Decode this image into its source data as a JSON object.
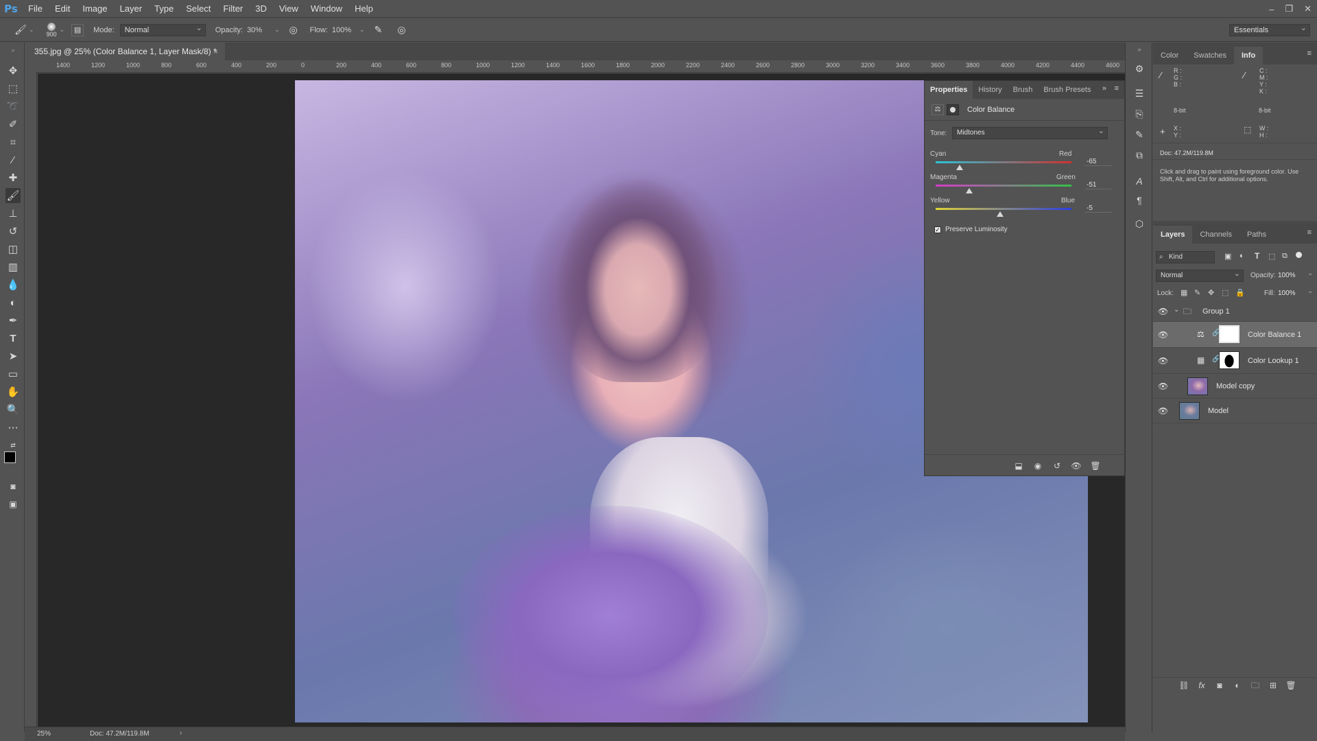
{
  "app": {
    "logo": "Ps"
  },
  "menu": [
    "File",
    "Edit",
    "Image",
    "Layer",
    "Type",
    "Select",
    "Filter",
    "3D",
    "View",
    "Window",
    "Help"
  ],
  "window_controls": {
    "minimize": "–",
    "restore": "❐",
    "close": "✕"
  },
  "options": {
    "brush_size": "900",
    "mode_label": "Mode:",
    "mode_value": "Normal",
    "opacity_label": "Opacity:",
    "opacity_value": "30%",
    "flow_label": "Flow:",
    "flow_value": "100%",
    "workspace": "Essentials"
  },
  "document": {
    "tab_title": "355.jpg @ 25% (Color Balance 1, Layer Mask/8) *",
    "close": "×",
    "ruler_h": [
      "1400",
      "1200",
      "1000",
      "800",
      "600",
      "400",
      "200",
      "0",
      "200",
      "400",
      "600",
      "800",
      "1000",
      "1200",
      "1400",
      "1600",
      "1800",
      "2000",
      "2200",
      "2400",
      "2600",
      "2800",
      "3000",
      "3200",
      "3400",
      "3600",
      "3800",
      "4000",
      "4200",
      "4400",
      "4600"
    ]
  },
  "status": {
    "zoom": "25%",
    "doc": "Doc: 47.2M/119.8M",
    "arrow": "›"
  },
  "properties": {
    "tabs": [
      "Properties",
      "History",
      "Brush",
      "Brush Presets"
    ],
    "title": "Color Balance",
    "tone_label": "Tone:",
    "tone_value": "Midtones",
    "sliders": [
      {
        "left": "Cyan",
        "right": "Red",
        "value": "-65",
        "amount": -65
      },
      {
        "left": "Magenta",
        "right": "Green",
        "value": "-51",
        "amount": -51
      },
      {
        "left": "Yellow",
        "right": "Blue",
        "value": "-5",
        "amount": -5
      }
    ],
    "preserve_label": "Preserve Luminosity",
    "preserve_checked": true
  },
  "info": {
    "tabs": [
      "Color",
      "Swatches",
      "Info"
    ],
    "rgb_labels": "R :\nG :\nB :",
    "cmyk_labels": "C :\nM :\nY :\nK :",
    "bit_left": "8-bit",
    "bit_right": "8-bit",
    "xy_labels": "X :\nY :",
    "wh_labels": "W :\nH :",
    "doc": "Doc: 47.2M/119.8M",
    "hint": "Click and drag to paint using foreground color. Use Shift, Alt, and Ctrl for additional options."
  },
  "layers": {
    "tabs": [
      "Layers",
      "Channels",
      "Paths"
    ],
    "kind": "Kind",
    "blend": "Normal",
    "opacity_label": "Opacity:",
    "opacity_value": "100%",
    "lock_label": "Lock:",
    "fill_label": "Fill:",
    "fill_value": "100%",
    "items": [
      {
        "name": "Group 1"
      },
      {
        "name": "Color Balance 1"
      },
      {
        "name": "Color Lookup 1"
      },
      {
        "name": "Model copy"
      },
      {
        "name": "Model"
      }
    ]
  }
}
